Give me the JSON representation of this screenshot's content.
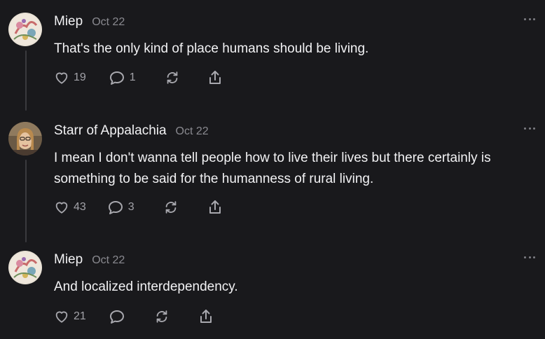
{
  "posts": [
    {
      "author": "Miep",
      "date": "Oct 22",
      "text": "That's the only kind of place humans should be living.",
      "likes": "19",
      "replies": "1",
      "avatar": "floral-collage-avatar"
    },
    {
      "author": "Starr of Appalachia",
      "date": "Oct 22",
      "text": "I mean I don't wanna tell people how to live their lives but there certainly is something to be said for the humanness of rural living.",
      "likes": "43",
      "replies": "3",
      "avatar": "portrait-photo-avatar"
    },
    {
      "author": "Miep",
      "date": "Oct 22",
      "text": "And localized interdependency.",
      "likes": "21",
      "replies": "",
      "avatar": "floral-collage-avatar"
    }
  ],
  "icons": {
    "like": "heart-icon",
    "reply": "speech-bubble-icon",
    "repost": "repost-icon",
    "share": "share-icon",
    "more": "more-options-icon"
  },
  "colors": {
    "background": "#19191c",
    "text": "#f2f2f4",
    "muted": "#8a8a90",
    "thread_line": "#3a3a3e"
  }
}
